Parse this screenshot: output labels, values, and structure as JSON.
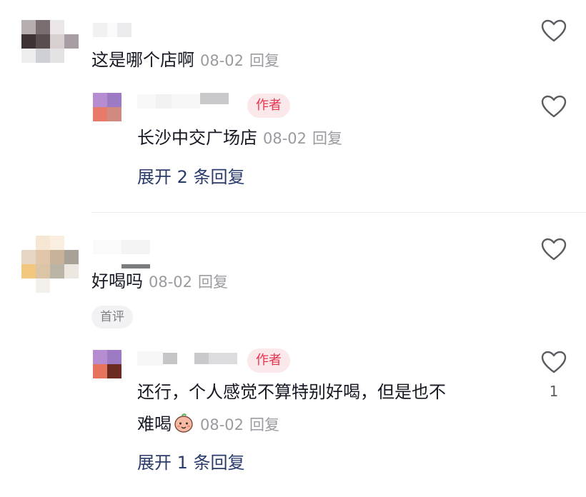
{
  "comments": [
    {
      "text": "这是哪个店啊",
      "date": "08-02",
      "reply_label": "回复",
      "reply": {
        "badge": "作者",
        "text": "长沙中交广场店",
        "date": "08-02",
        "reply_label": "回复"
      },
      "expand_label": "展开 2 条回复"
    },
    {
      "text": "好喝吗",
      "date": "08-02",
      "reply_label": "回复",
      "first_badge": "首评",
      "reply": {
        "badge": "作者",
        "text_line1": "还行，个人感觉不算特别好喝，但是也不",
        "text_line2": "难喝",
        "emoji": "smiling-face-emoji",
        "date": "08-02",
        "reply_label": "回复",
        "like_count": "1"
      },
      "expand_label": "展开 1 条回复"
    }
  ],
  "icons": {
    "like": "heart-outline-icon"
  },
  "colors": {
    "author_badge_bg": "#fbe8ea",
    "author_badge_text": "#e8344f",
    "link_text": "#2a3a6b",
    "meta_text": "#9a9ba0"
  }
}
